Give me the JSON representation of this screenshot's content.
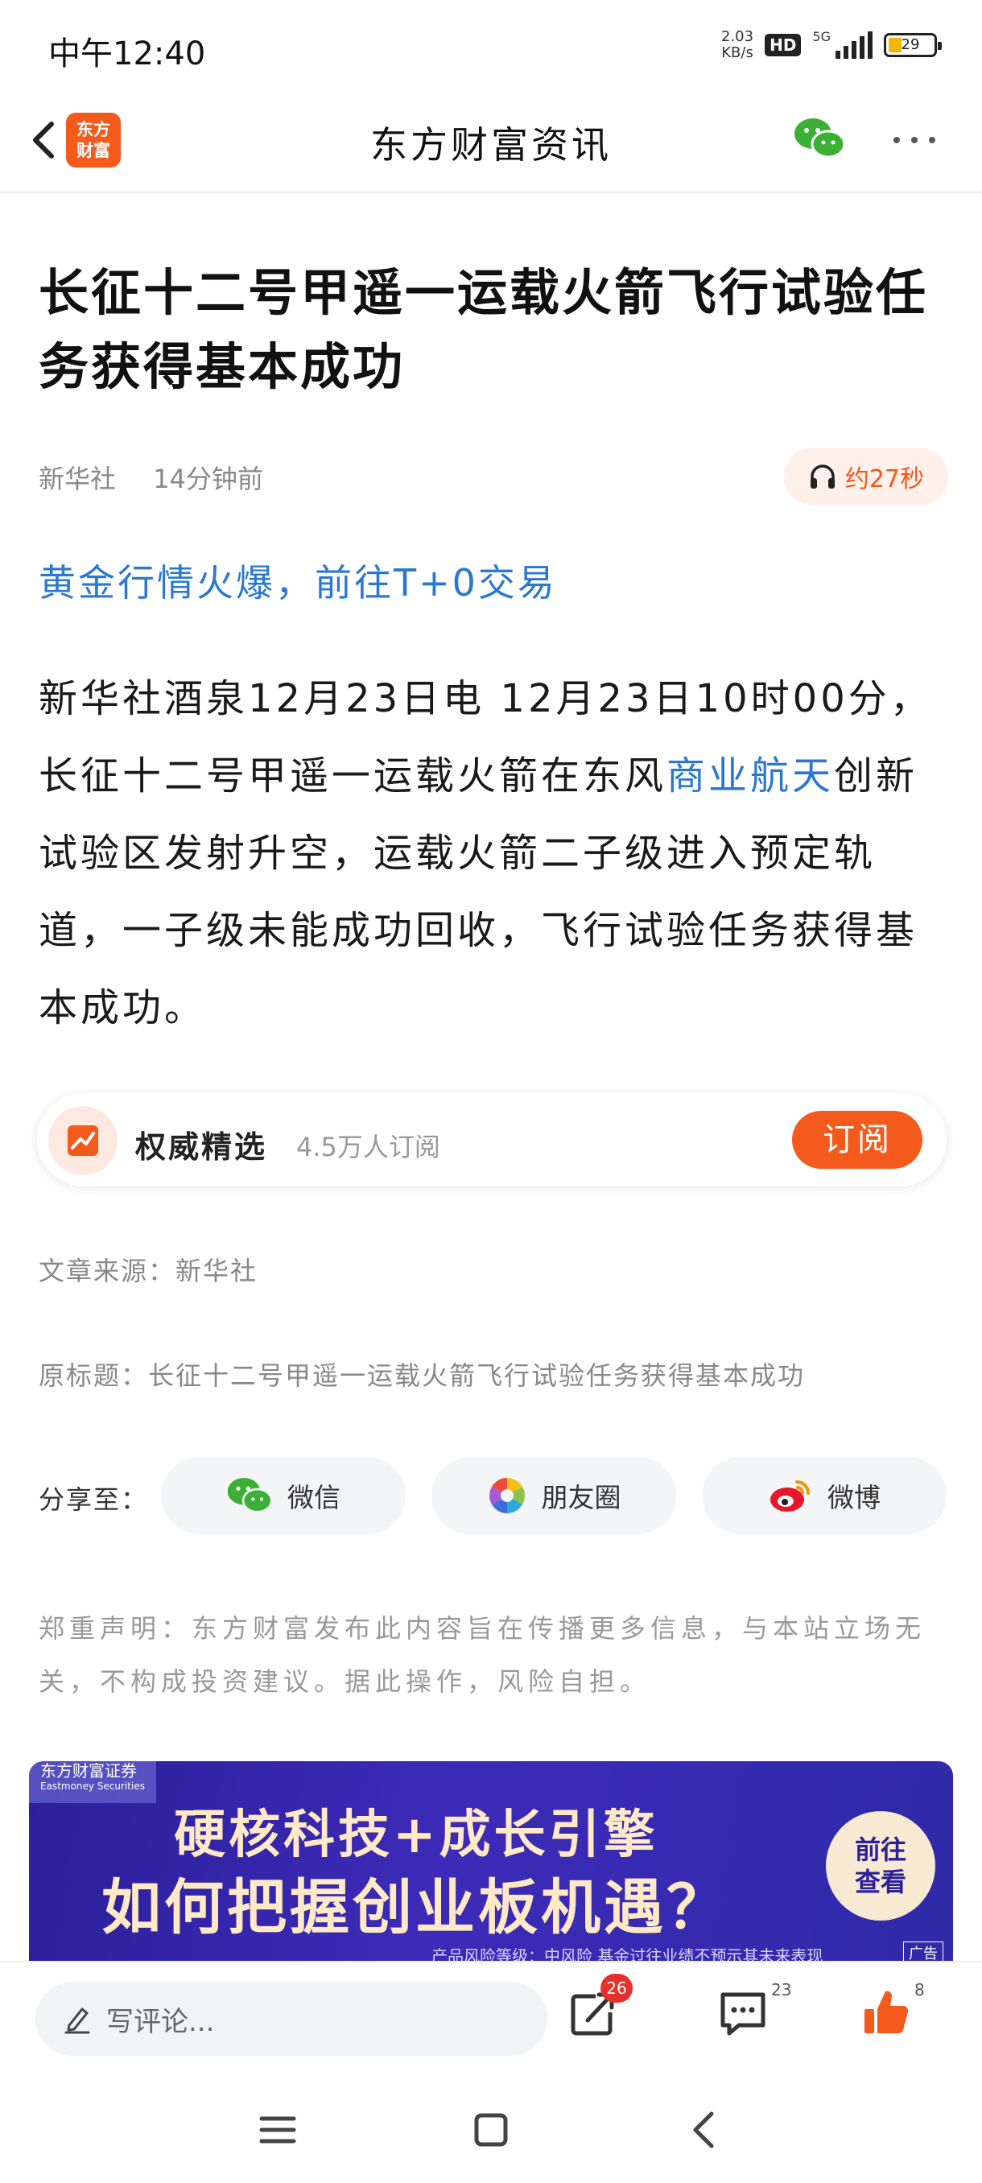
{
  "status_bar": {
    "time": "中午12:40",
    "net_speed_value": "2.03",
    "net_speed_unit": "KB/s",
    "hd": "HD",
    "network": "5G",
    "battery": "29"
  },
  "nav": {
    "logo_line1": "东方",
    "logo_line2": "财富",
    "title": "东方财富资讯"
  },
  "article": {
    "headline": "长征十二号甲遥一运载火箭飞行试验任务获得基本成功",
    "source": "新华社",
    "time_ago": "14分钟前",
    "listen_label": "约27秒",
    "promo_link": "黄金行情火爆，前往T+0交易",
    "body_before": "新华社酒泉12月23日电 12月23日10时00分，长征十二号甲遥一运载火箭在东风",
    "body_keyword": "商业航天",
    "body_after": "创新试验区发射升空，运载火箭二子级进入预定轨道，一子级未能成功回收，飞行试验任务获得基本成功。"
  },
  "subscription": {
    "name": "权威精选",
    "subscribers": "4.5万人订阅",
    "button": "订阅"
  },
  "source_line": "文章来源：新华社",
  "original_title": "原标题：长征十二号甲遥一运载火箭飞行试验任务获得基本成功",
  "share": {
    "label": "分享至：",
    "options": [
      "微信",
      "朋友圈",
      "微博"
    ]
  },
  "disclaimer": "郑重声明：东方财富发布此内容旨在传播更多信息，与本站立场无关，不构成投资建议。据此操作，风险自担。",
  "ad": {
    "brand": "东方财富证券",
    "brand_en": "Eastmoney Securities",
    "line1": "硬核科技+成长引擎",
    "line2": "如何把握创业板机遇？",
    "cta_line1": "前往",
    "cta_line2": "查看",
    "risk": "产品风险等级：中风险    基金过往业绩不预示其未来表现",
    "tag": "广告"
  },
  "bottom_bar": {
    "comment_placeholder": "写评论...",
    "share_count": "26",
    "comment_count": "23",
    "like_count": "8"
  },
  "colors": {
    "brand_orange": "#f45a1c",
    "link_blue": "#2a78d0",
    "badge_red": "#e8302a"
  },
  "icons": [
    "back-arrow-icon",
    "wechat-icon",
    "more-icon",
    "headphones-icon",
    "chart-trend-icon",
    "moments-icon",
    "weibo-icon",
    "pencil-icon",
    "share-icon",
    "comment-icon",
    "thumbs-up-icon",
    "menu-icon",
    "home-square-icon",
    "back-chevron-icon"
  ]
}
